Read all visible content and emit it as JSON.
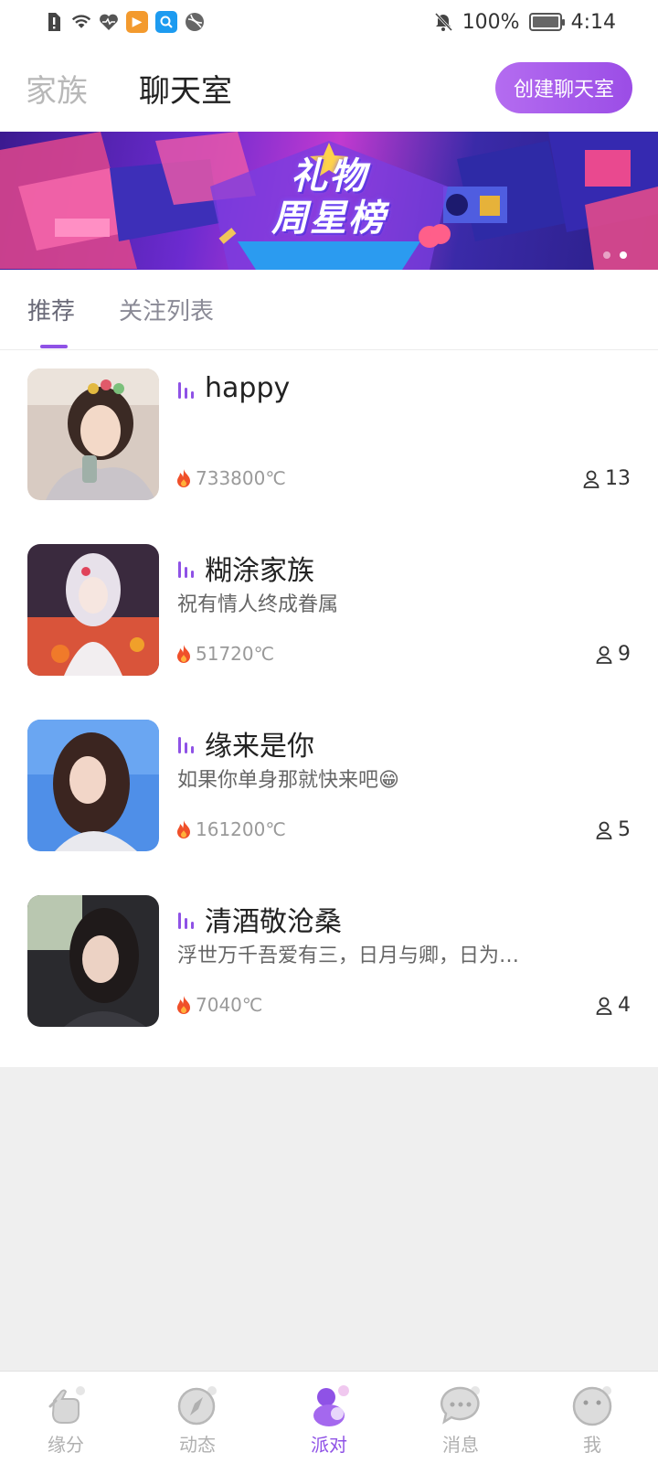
{
  "status_bar": {
    "battery_text": "100%",
    "time": "4:14",
    "icons": [
      "sim-alert-icon",
      "wifi-icon",
      "health-icon",
      "video-app-icon",
      "search-app-icon",
      "browser-app-icon",
      "mute-bell-icon",
      "battery-icon"
    ]
  },
  "header": {
    "tabs": [
      {
        "label": "家族",
        "active": false
      },
      {
        "label": "聊天室",
        "active": true
      }
    ],
    "create_button": "创建聊天室"
  },
  "banner": {
    "title_line1": "礼物",
    "title_line2": "周星榜",
    "dots": 2,
    "active_dot": 1
  },
  "subtabs": [
    {
      "label": "推荐",
      "active": true
    },
    {
      "label": "关注列表",
      "active": false
    }
  ],
  "rooms": [
    {
      "name": "happy",
      "desc": "",
      "heat": "733800℃",
      "members": "13"
    },
    {
      "name": "糊涂家族",
      "desc": "祝有情人终成眷属",
      "heat": "51720℃",
      "members": "9"
    },
    {
      "name": "缘来是你",
      "desc": "如果你单身那就快来吧😁",
      "heat": "161200℃",
      "members": "5"
    },
    {
      "name": "清酒敬沧桑",
      "desc": "浮世万千吾爱有三，日月与卿，日为…",
      "heat": "7040℃",
      "members": "4"
    }
  ],
  "bottom_nav": [
    {
      "label": "缘分",
      "icon": "hand-icon",
      "active": false
    },
    {
      "label": "动态",
      "icon": "compass-icon",
      "active": false
    },
    {
      "label": "派对",
      "icon": "party-icon",
      "active": true
    },
    {
      "label": "消息",
      "icon": "chat-bubble-icon",
      "active": false
    },
    {
      "label": "我",
      "icon": "profile-face-icon",
      "active": false
    }
  ],
  "colors": {
    "accent": "#8f52e6",
    "button_gradient_start": "#b46cf0",
    "button_gradient_end": "#9b4de6",
    "heat_icon": "#f0502a"
  }
}
